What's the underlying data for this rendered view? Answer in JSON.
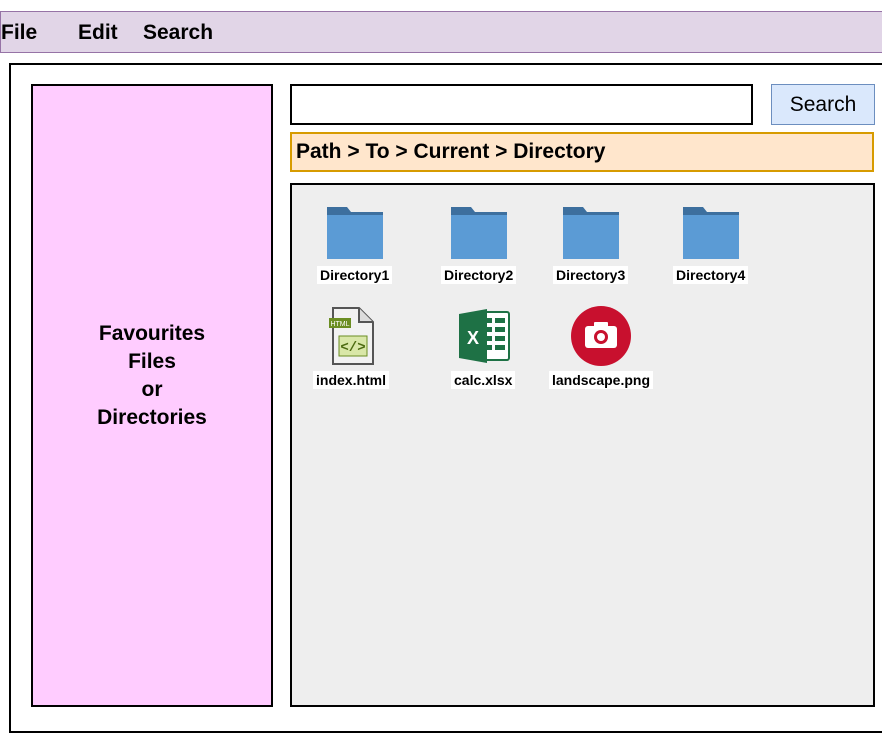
{
  "menubar": {
    "items": [
      "File",
      "Edit",
      "Search"
    ]
  },
  "sidebar": {
    "line1": "Favourites",
    "line2": "Files",
    "line3": "or",
    "line4": "Directories"
  },
  "search": {
    "value": "",
    "button_label": "Search"
  },
  "breadcrumb": {
    "path": "Path > To > Current > Directory"
  },
  "browser": {
    "directories": [
      {
        "name": "Directory1",
        "icon": "folder-icon"
      },
      {
        "name": "Directory2",
        "icon": "folder-icon"
      },
      {
        "name": "Directory3",
        "icon": "folder-icon"
      },
      {
        "name": "Directory4",
        "icon": "folder-icon"
      }
    ],
    "files": [
      {
        "name": "index.html",
        "icon": "html-file-icon"
      },
      {
        "name": "calc.xlsx",
        "icon": "excel-file-icon"
      },
      {
        "name": "landscape.png",
        "icon": "camera-image-icon"
      }
    ]
  },
  "colors": {
    "menubar_bg": "#e1d5e7",
    "sidebar_bg": "#ffccff",
    "breadcrumb_bg": "#ffe6cc",
    "search_button_bg": "#dae8fc",
    "browser_bg": "#eeeeee",
    "folder_blue": "#5b9bd5",
    "excel_green": "#1e7145",
    "image_red": "#c8102e"
  }
}
